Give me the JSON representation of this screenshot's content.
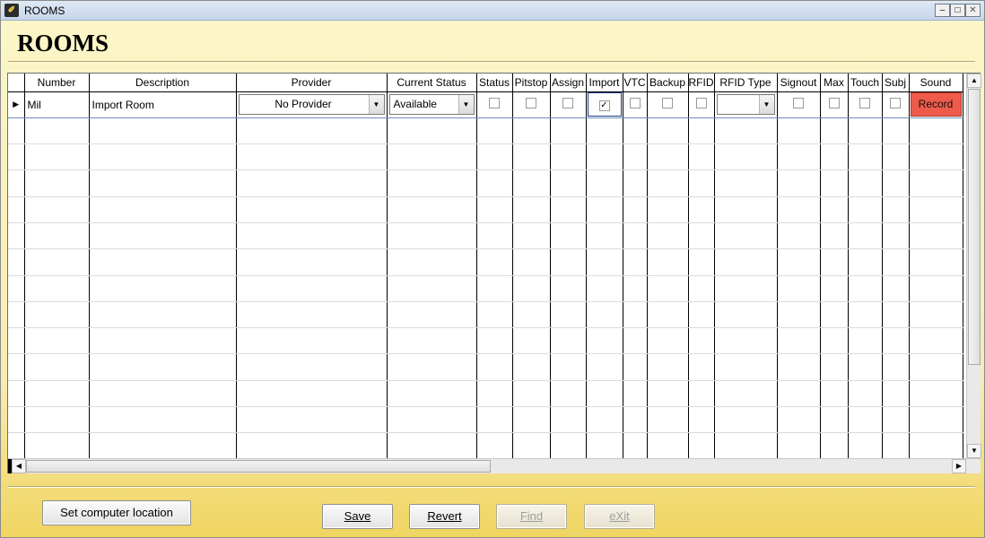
{
  "window": {
    "title": "ROOMS",
    "heading": "ROOMS"
  },
  "grid": {
    "columns": [
      "",
      "Number",
      "Description",
      "Provider",
      "Current Status",
      "Status",
      "Pitstop",
      "Assign",
      "Import",
      "VTC",
      "Backup",
      "RFID",
      "RFID Type",
      "Signout",
      "Max",
      "Touch",
      "Subj",
      "Sound"
    ],
    "row": {
      "number": "Mil",
      "description": "Import Room",
      "provider": "No Provider",
      "current_status": "Available",
      "status": false,
      "pitstop": false,
      "assign": false,
      "import": true,
      "vtc": false,
      "backup": false,
      "rfid": false,
      "rfid_type": "",
      "signout": false,
      "max": false,
      "touch": false,
      "subj": false,
      "sound_label": "Record"
    }
  },
  "buttons": {
    "set_location": "Set computer location",
    "save": "Save",
    "revert": "Revert",
    "find": "Find",
    "exit": "eXit"
  },
  "colors": {
    "record_button": "#ef5b4a",
    "background_top": "#fcf6c9",
    "background_bottom": "#f0d561"
  }
}
